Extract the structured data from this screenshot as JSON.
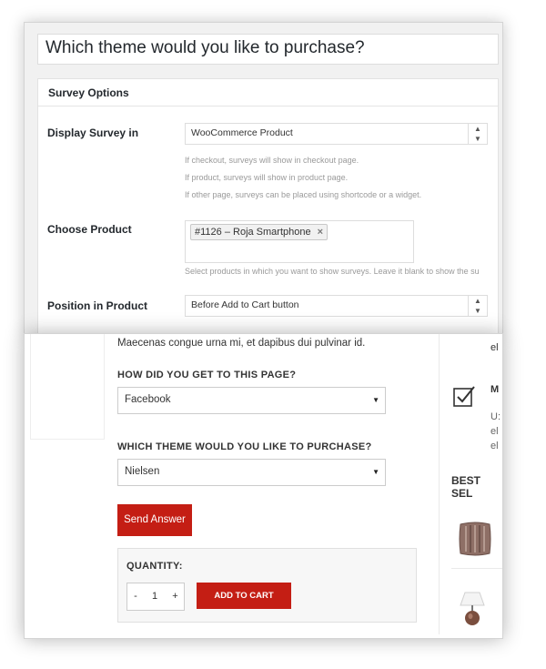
{
  "admin": {
    "title_field": "Which theme would you like to purchase?",
    "section_title": "Survey Options",
    "display_survey": {
      "label": "Display Survey in",
      "value": "WooCommerce Product",
      "hints": [
        "If checkout, surveys will show in checkout page.",
        "If product, surveys will show in product page.",
        "If other page, surveys can be placed using shortcode or a widget."
      ]
    },
    "choose_product": {
      "label": "Choose Product",
      "tag": "#1126 – Roja Smartphone",
      "remove_glyph": "×",
      "hint": "Select products in which you want to show surveys. Leave it blank to show the su"
    },
    "position": {
      "label": "Position in Product",
      "value": "Before Add to Cart button"
    }
  },
  "front": {
    "intro_text": "Maecenas congue urna mi, et dapibus dui pulvinar id.",
    "question1": {
      "label": "HOW DID YOU GET TO THIS PAGE?",
      "value": "Facebook"
    },
    "question2": {
      "label": "WHICH THEME WOULD YOU LIKE TO PURCHASE?",
      "value": "Nielsen"
    },
    "send_button": "Send Answer",
    "quantity": {
      "label": "QUANTITY:",
      "minus": "-",
      "value": "1",
      "plus": "+"
    },
    "add_to_cart": "ADD TO CART",
    "sidebar": {
      "frag_top": "el",
      "frag_m": "M",
      "frag_lines": [
        "U:",
        "el",
        "el"
      ],
      "best_sellers": "BEST SEL"
    }
  },
  "colors": {
    "accent_red": "#c41e14"
  }
}
